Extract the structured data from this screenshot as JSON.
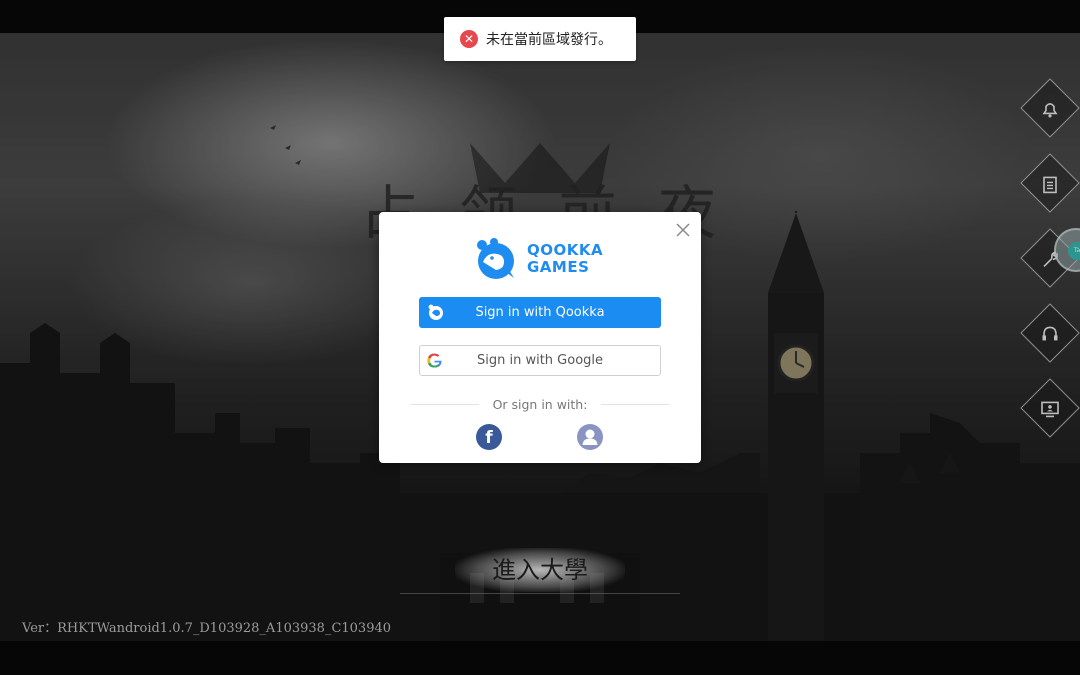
{
  "toast": {
    "icon": "error-x-icon",
    "message": "未在當前區域發行。",
    "accent_color": "#e5484d"
  },
  "game": {
    "title_chars": [
      "占",
      "领",
      "前",
      "夜"
    ],
    "enter_button_label": "進入大學",
    "version": "Ver：RHKTWandroid1.0.7_D103928_A103938_C103940"
  },
  "side_menu": {
    "items": [
      {
        "icon": "bell-icon"
      },
      {
        "icon": "clipboard-icon"
      },
      {
        "icon": "wrench-icon"
      },
      {
        "icon": "headset-icon"
      },
      {
        "icon": "monitor-user-icon"
      }
    ],
    "floating_assist_icon": "floating-assistant-icon"
  },
  "login": {
    "brand_line1": "QOOKKA",
    "brand_line2": "GAMES",
    "brand_color": "#1f8cf0",
    "qookka_button": "Sign in with Qookka",
    "google_button": "Sign in with Google",
    "or_text": "Or sign in with:",
    "social": [
      {
        "icon": "facebook-icon",
        "color": "#3a5998"
      },
      {
        "icon": "guest-user-icon",
        "color": "#8a94c2"
      }
    ]
  }
}
